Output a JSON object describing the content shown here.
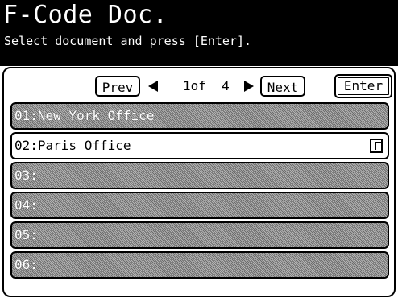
{
  "header": {
    "title": "F-Code Doc.",
    "subtitle": "Select document and press [Enter]."
  },
  "toolbar": {
    "prev_label": "Prev",
    "next_label": "Next",
    "enter_label": "Enter",
    "page_text": "1of  4"
  },
  "list": {
    "items": [
      {
        "label": "01:New York Office",
        "state": "disabled"
      },
      {
        "label": "02:Paris Office",
        "state": "active",
        "icon": "document-icon"
      },
      {
        "label": "03:",
        "state": "disabled"
      },
      {
        "label": "04:",
        "state": "disabled"
      },
      {
        "label": "05:",
        "state": "disabled"
      },
      {
        "label": "06:",
        "state": "disabled"
      }
    ]
  },
  "colors": {
    "header_bg": "#000000",
    "header_text": "#ffffff",
    "disabled_row": "#8a8a8a"
  }
}
